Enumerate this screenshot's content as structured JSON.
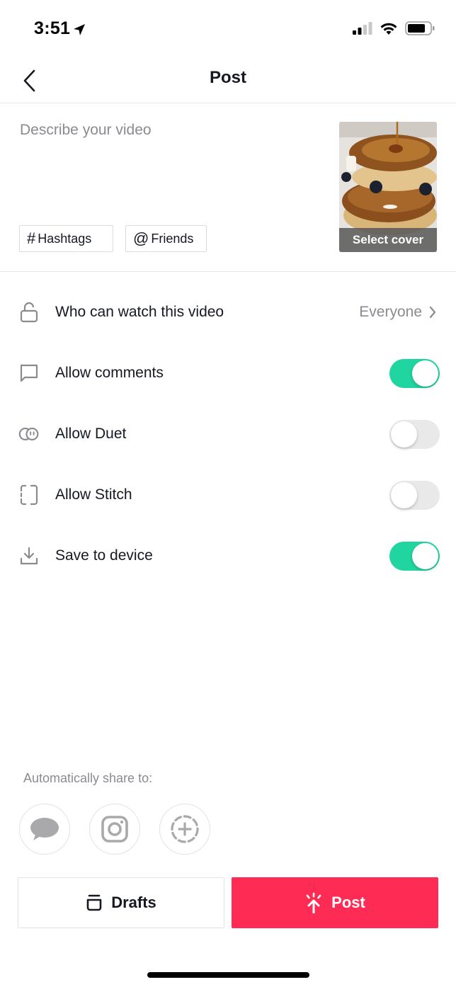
{
  "status_bar": {
    "time": "3:51",
    "icons": [
      "location-arrow-icon",
      "cellular-signal-icon",
      "wifi-icon",
      "battery-icon"
    ]
  },
  "nav": {
    "title": "Post",
    "back_icon": "chevron-left-icon"
  },
  "caption": {
    "placeholder": "Describe your video",
    "value": "",
    "hashtags_label": "Hashtags",
    "hashtags_icon": "#",
    "friends_label": "Friends",
    "friends_icon": "@",
    "cover_label": "Select cover"
  },
  "settings": {
    "privacy": {
      "icon": "unlock-icon",
      "label": "Who can watch this video",
      "value": "Everyone"
    },
    "toggles": [
      {
        "icon": "comment-icon",
        "label": "Allow comments",
        "on": true
      },
      {
        "icon": "duet-icon",
        "label": "Allow Duet",
        "on": false
      },
      {
        "icon": "stitch-icon",
        "label": "Allow Stitch",
        "on": false
      },
      {
        "icon": "download-icon",
        "label": "Save to device",
        "on": true
      }
    ]
  },
  "share": {
    "label": "Automatically share to:",
    "targets": [
      "messages-icon",
      "instagram-icon",
      "add-story-icon"
    ]
  },
  "actions": {
    "drafts_label": "Drafts",
    "post_label": "Post"
  },
  "colors": {
    "accent": "#fe2c55",
    "toggle_on": "#20d5a0",
    "toggle_off": "#e9e9ea",
    "secondary_text": "#8a8b91"
  }
}
